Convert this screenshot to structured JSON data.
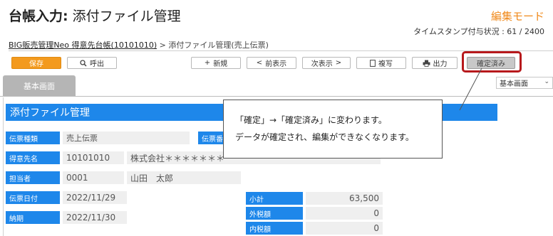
{
  "header": {
    "title_prefix": "台帳入力:",
    "title_main": "添付ファイル管理",
    "mode": "編集モード",
    "timestamp_status": "タイムスタンプ付与状況 : 61 / 2400"
  },
  "breadcrumb": {
    "link": "BIG販売管理Neo 得意先台帳(10101010)",
    "separator": ">",
    "current": "添付ファイル管理(売上伝票)"
  },
  "toolbar": {
    "save": "保存",
    "call": "呼出",
    "new": "新規",
    "prev": "前表示",
    "next": "次表示",
    "copy": "複写",
    "print": "出力",
    "confirmed": "確定済み"
  },
  "tabs": {
    "basic": "基本画面"
  },
  "view_select": {
    "value": "基本画面"
  },
  "section": {
    "title": "添付ファイル管理"
  },
  "form": {
    "slip_type_label": "伝票種類",
    "slip_type_value": "売上伝票",
    "slip_no_label": "伝票番",
    "customer_label": "得意先名",
    "customer_code": "10101010",
    "customer_name": "株式会社＊＊＊＊＊＊＊",
    "staff_label": "担当者",
    "staff_code": "0001",
    "staff_name": "山田　太郎",
    "slip_date_label": "伝票日付",
    "slip_date_value": "2022/11/29",
    "delivery_label": "納期",
    "delivery_value": "2022/11/30",
    "subtotal_label": "小計",
    "subtotal_value": "63,500",
    "ext_tax_label": "外税額",
    "ext_tax_value": "0",
    "int_tax_label": "内税額",
    "int_tax_value": "0"
  },
  "callout": {
    "line1": "「確定」→「確定済み」に変わります。",
    "line2": "データが確定され、編集ができなくなります。"
  },
  "colors": {
    "accent": "#1e87ea",
    "mode": "#f08a1c",
    "save": "#f39a1e",
    "highlight": "#b7191c"
  }
}
